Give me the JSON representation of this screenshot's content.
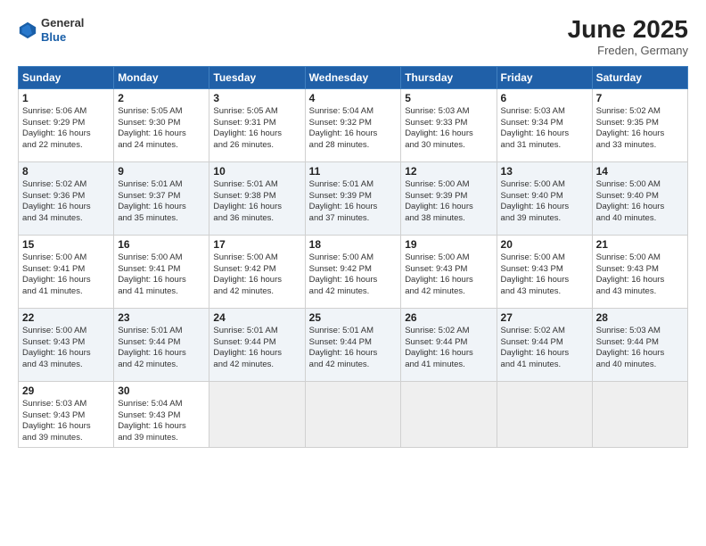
{
  "header": {
    "logo": {
      "general": "General",
      "blue": "Blue"
    },
    "title": "June 2025",
    "location": "Freden, Germany"
  },
  "columns": [
    "Sunday",
    "Monday",
    "Tuesday",
    "Wednesday",
    "Thursday",
    "Friday",
    "Saturday"
  ],
  "weeks": [
    [
      {
        "day": "1",
        "lines": [
          "Sunrise: 5:06 AM",
          "Sunset: 9:29 PM",
          "Daylight: 16 hours",
          "and 22 minutes."
        ]
      },
      {
        "day": "2",
        "lines": [
          "Sunrise: 5:05 AM",
          "Sunset: 9:30 PM",
          "Daylight: 16 hours",
          "and 24 minutes."
        ]
      },
      {
        "day": "3",
        "lines": [
          "Sunrise: 5:05 AM",
          "Sunset: 9:31 PM",
          "Daylight: 16 hours",
          "and 26 minutes."
        ]
      },
      {
        "day": "4",
        "lines": [
          "Sunrise: 5:04 AM",
          "Sunset: 9:32 PM",
          "Daylight: 16 hours",
          "and 28 minutes."
        ]
      },
      {
        "day": "5",
        "lines": [
          "Sunrise: 5:03 AM",
          "Sunset: 9:33 PM",
          "Daylight: 16 hours",
          "and 30 minutes."
        ]
      },
      {
        "day": "6",
        "lines": [
          "Sunrise: 5:03 AM",
          "Sunset: 9:34 PM",
          "Daylight: 16 hours",
          "and 31 minutes."
        ]
      },
      {
        "day": "7",
        "lines": [
          "Sunrise: 5:02 AM",
          "Sunset: 9:35 PM",
          "Daylight: 16 hours",
          "and 33 minutes."
        ]
      }
    ],
    [
      {
        "day": "8",
        "lines": [
          "Sunrise: 5:02 AM",
          "Sunset: 9:36 PM",
          "Daylight: 16 hours",
          "and 34 minutes."
        ]
      },
      {
        "day": "9",
        "lines": [
          "Sunrise: 5:01 AM",
          "Sunset: 9:37 PM",
          "Daylight: 16 hours",
          "and 35 minutes."
        ]
      },
      {
        "day": "10",
        "lines": [
          "Sunrise: 5:01 AM",
          "Sunset: 9:38 PM",
          "Daylight: 16 hours",
          "and 36 minutes."
        ]
      },
      {
        "day": "11",
        "lines": [
          "Sunrise: 5:01 AM",
          "Sunset: 9:39 PM",
          "Daylight: 16 hours",
          "and 37 minutes."
        ]
      },
      {
        "day": "12",
        "lines": [
          "Sunrise: 5:00 AM",
          "Sunset: 9:39 PM",
          "Daylight: 16 hours",
          "and 38 minutes."
        ]
      },
      {
        "day": "13",
        "lines": [
          "Sunrise: 5:00 AM",
          "Sunset: 9:40 PM",
          "Daylight: 16 hours",
          "and 39 minutes."
        ]
      },
      {
        "day": "14",
        "lines": [
          "Sunrise: 5:00 AM",
          "Sunset: 9:40 PM",
          "Daylight: 16 hours",
          "and 40 minutes."
        ]
      }
    ],
    [
      {
        "day": "15",
        "lines": [
          "Sunrise: 5:00 AM",
          "Sunset: 9:41 PM",
          "Daylight: 16 hours",
          "and 41 minutes."
        ]
      },
      {
        "day": "16",
        "lines": [
          "Sunrise: 5:00 AM",
          "Sunset: 9:41 PM",
          "Daylight: 16 hours",
          "and 41 minutes."
        ]
      },
      {
        "day": "17",
        "lines": [
          "Sunrise: 5:00 AM",
          "Sunset: 9:42 PM",
          "Daylight: 16 hours",
          "and 42 minutes."
        ]
      },
      {
        "day": "18",
        "lines": [
          "Sunrise: 5:00 AM",
          "Sunset: 9:42 PM",
          "Daylight: 16 hours",
          "and 42 minutes."
        ]
      },
      {
        "day": "19",
        "lines": [
          "Sunrise: 5:00 AM",
          "Sunset: 9:43 PM",
          "Daylight: 16 hours",
          "and 42 minutes."
        ]
      },
      {
        "day": "20",
        "lines": [
          "Sunrise: 5:00 AM",
          "Sunset: 9:43 PM",
          "Daylight: 16 hours",
          "and 43 minutes."
        ]
      },
      {
        "day": "21",
        "lines": [
          "Sunrise: 5:00 AM",
          "Sunset: 9:43 PM",
          "Daylight: 16 hours",
          "and 43 minutes."
        ]
      }
    ],
    [
      {
        "day": "22",
        "lines": [
          "Sunrise: 5:00 AM",
          "Sunset: 9:43 PM",
          "Daylight: 16 hours",
          "and 43 minutes."
        ]
      },
      {
        "day": "23",
        "lines": [
          "Sunrise: 5:01 AM",
          "Sunset: 9:44 PM",
          "Daylight: 16 hours",
          "and 42 minutes."
        ]
      },
      {
        "day": "24",
        "lines": [
          "Sunrise: 5:01 AM",
          "Sunset: 9:44 PM",
          "Daylight: 16 hours",
          "and 42 minutes."
        ]
      },
      {
        "day": "25",
        "lines": [
          "Sunrise: 5:01 AM",
          "Sunset: 9:44 PM",
          "Daylight: 16 hours",
          "and 42 minutes."
        ]
      },
      {
        "day": "26",
        "lines": [
          "Sunrise: 5:02 AM",
          "Sunset: 9:44 PM",
          "Daylight: 16 hours",
          "and 41 minutes."
        ]
      },
      {
        "day": "27",
        "lines": [
          "Sunrise: 5:02 AM",
          "Sunset: 9:44 PM",
          "Daylight: 16 hours",
          "and 41 minutes."
        ]
      },
      {
        "day": "28",
        "lines": [
          "Sunrise: 5:03 AM",
          "Sunset: 9:44 PM",
          "Daylight: 16 hours",
          "and 40 minutes."
        ]
      }
    ],
    [
      {
        "day": "29",
        "lines": [
          "Sunrise: 5:03 AM",
          "Sunset: 9:43 PM",
          "Daylight: 16 hours",
          "and 39 minutes."
        ]
      },
      {
        "day": "30",
        "lines": [
          "Sunrise: 5:04 AM",
          "Sunset: 9:43 PM",
          "Daylight: 16 hours",
          "and 39 minutes."
        ]
      },
      {
        "day": "",
        "lines": []
      },
      {
        "day": "",
        "lines": []
      },
      {
        "day": "",
        "lines": []
      },
      {
        "day": "",
        "lines": []
      },
      {
        "day": "",
        "lines": []
      }
    ]
  ]
}
